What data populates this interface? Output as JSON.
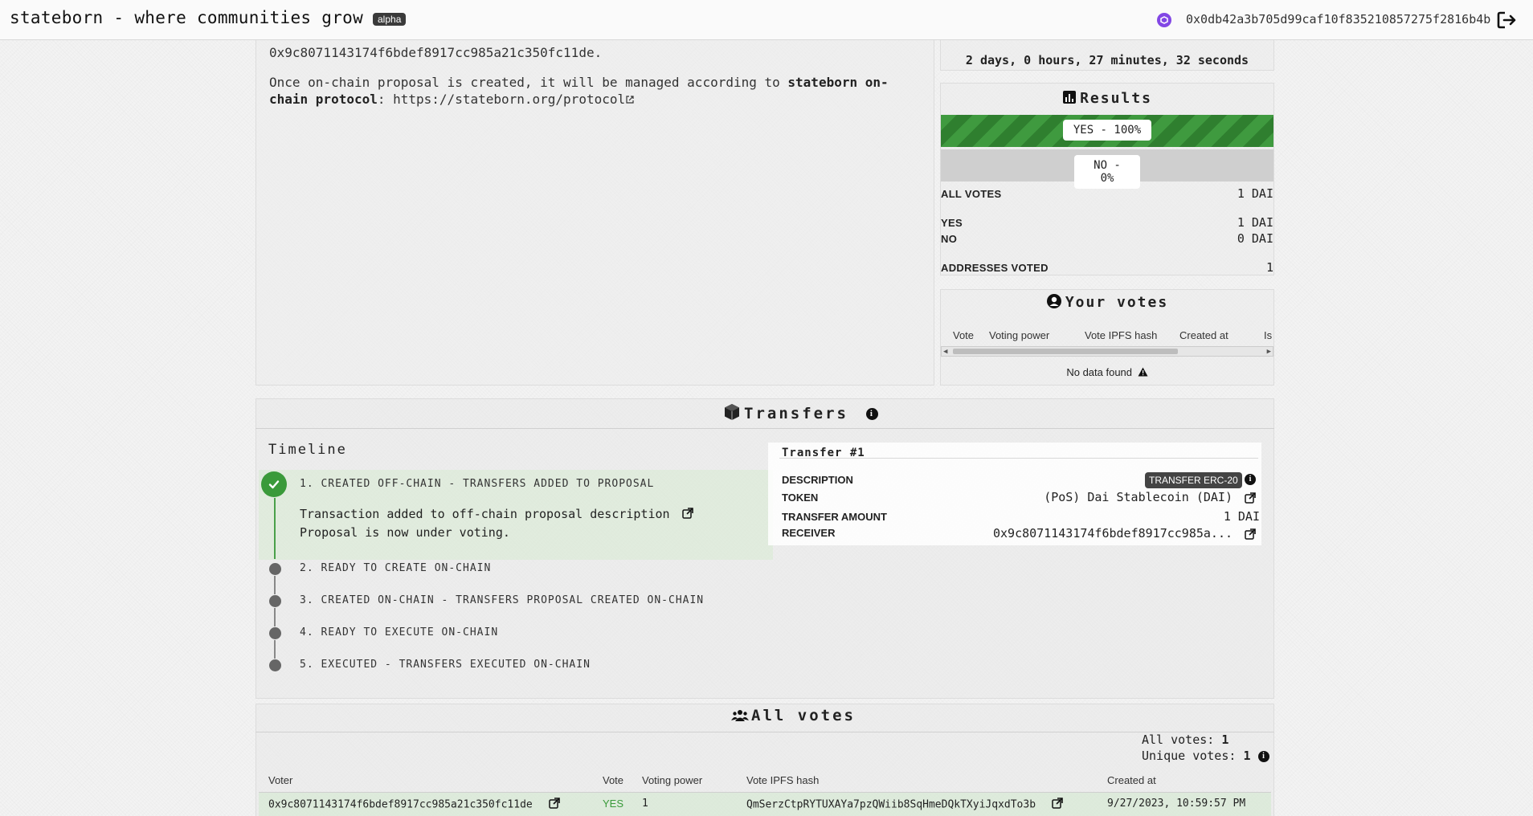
{
  "header": {
    "brand": "stateborn - where communities grow",
    "badge": "alpha",
    "wallet_address": "0x0db42a3b705d99caf10f835210857275f2816b4b"
  },
  "description": {
    "address_line": "0x9c8071143174f6bdef8917cc985a21c350fc11de.",
    "managed_prefix": "Once on-chain proposal is created, it will be managed according to ",
    "protocol_bold_1": "stateborn on-",
    "protocol_bold_2": "chain protocol",
    "protocol_sep": ": ",
    "protocol_link": "https://stateborn.org/protocol"
  },
  "countdown": "2 days, 0 hours, 27 minutes, 32 seconds",
  "results": {
    "title": "Results",
    "yes_label": "YES - 100%",
    "no_label": "NO - 0%",
    "yes_fraction": 1.0,
    "no_fraction": 0.0,
    "all_votes_key": "ALL VOTES",
    "all_votes_val": "1 DAI",
    "yes_key": "YES",
    "yes_val": "1 DAI",
    "no_key": "NO",
    "no_val": "0 DAI",
    "addresses_key": "ADDRESSES VOTED",
    "addresses_val": "1"
  },
  "your_votes": {
    "title": "Your votes",
    "columns": [
      "Vote",
      "Voting power",
      "Vote IPFS hash",
      "Created at",
      "Is"
    ],
    "empty": "No data found"
  },
  "transfers": {
    "title": "Transfers",
    "timeline_label": "Timeline",
    "steps": [
      "1. CREATED OFF-CHAIN - TRANSFERS ADDED TO PROPOSAL",
      "2. READY TO CREATE ON-CHAIN",
      "3. CREATED ON-CHAIN - TRANSFERS PROPOSAL CREATED ON-CHAIN",
      "4. READY TO EXECUTE ON-CHAIN",
      "5. EXECUTED - TRANSFERS EXECUTED ON-CHAIN"
    ],
    "step1_body_1": "Transaction added to off-chain proposal description",
    "step1_body_2": "Proposal is now under voting.",
    "card": {
      "title": "Transfer #1",
      "description_key": "DESCRIPTION",
      "description_badge": "TRANSFER ERC-20",
      "token_key": "TOKEN",
      "token_val": "(PoS) Dai Stablecoin (DAI)",
      "amount_key": "TRANSFER AMOUNT",
      "amount_val": "1 DAI",
      "receiver_key": "RECEIVER",
      "receiver_val": "0x9c8071143174f6bdef8917cc985a..."
    }
  },
  "all_votes": {
    "title": "All votes",
    "all_votes_label": "All votes:",
    "all_votes_count": "1",
    "unique_votes_label": "Unique votes:",
    "unique_votes_count": "1",
    "columns": [
      "Voter",
      "Vote",
      "Voting power",
      "Vote IPFS hash",
      "Created at"
    ],
    "row": {
      "voter": "0x9c8071143174f6bdef8917cc985a21c350fc11de",
      "vote": "YES",
      "voting_power": "1",
      "ipfs_hash": "QmSerzCtpRYTUXAYa7pzQWiib8SqHmeDQkTXyiJqxdTo3b",
      "created_at": "9/27/2023, 10:59:57 PM"
    }
  },
  "colors": {
    "accent_green": "#3a9a3a",
    "wallet_purple": "#8247e5",
    "yes_text": "#3a9a3a"
  }
}
